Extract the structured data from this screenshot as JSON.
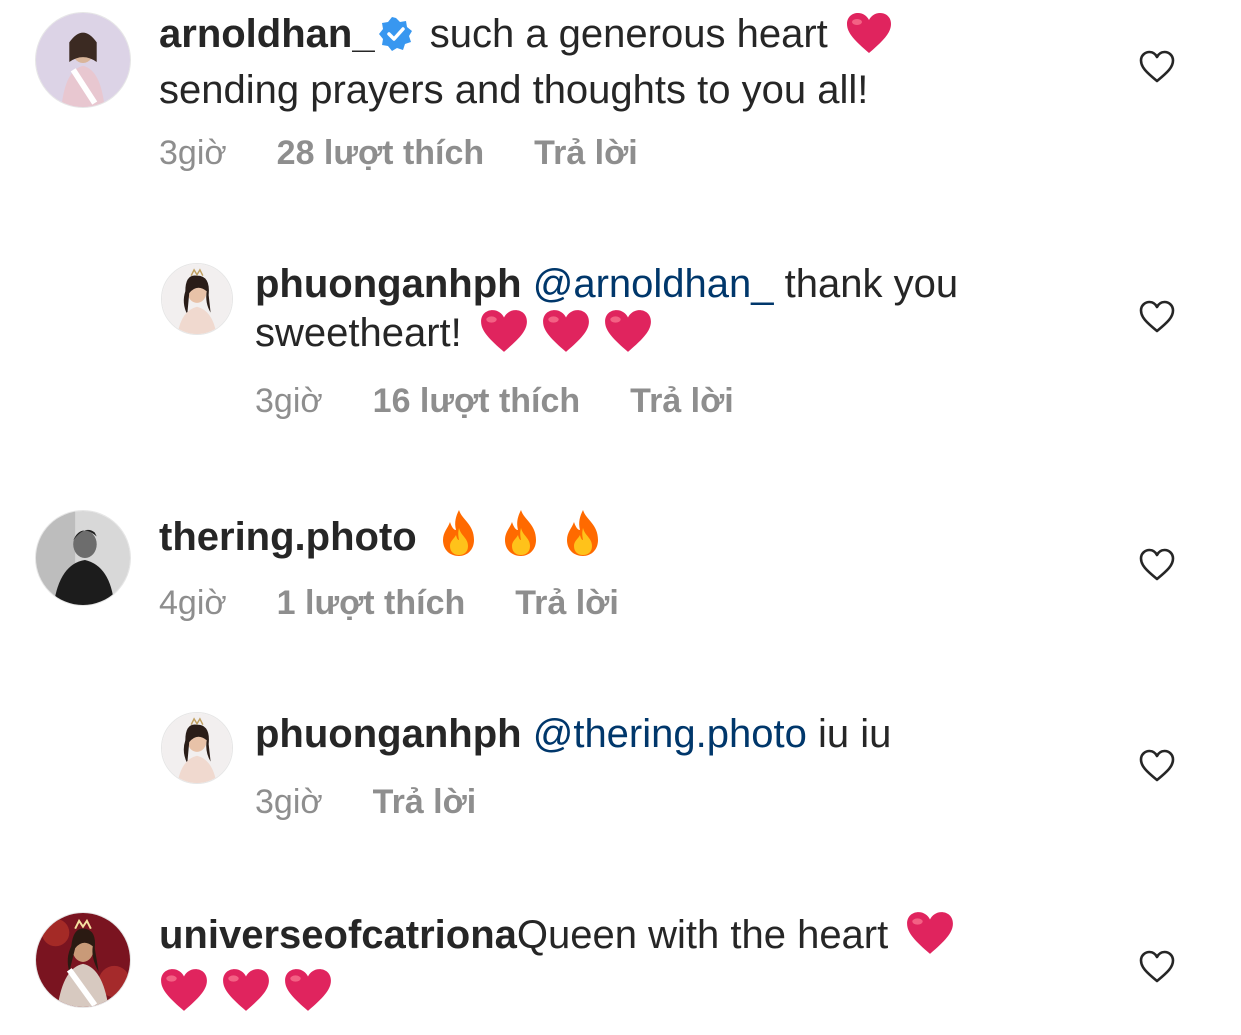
{
  "comments": [
    {
      "username": "arnoldhan_",
      "verified": true,
      "text_line1": "such a generous heart",
      "text_line2": "sending prayers and thoughts to you all!",
      "time": "3giờ",
      "likes": "28 lượt thích",
      "reply": "Trả lời"
    },
    {
      "username": "phuonganhph",
      "mention": "@arnoldhan_",
      "text_line1": "thank you",
      "text_line2": "sweetheart!",
      "time": "3giờ",
      "likes": "16 lượt thích",
      "reply": "Trả lời"
    },
    {
      "username": "thering.photo",
      "time": "4giờ",
      "likes": "1 lượt thích",
      "reply": "Trả lời"
    },
    {
      "username": "phuonganhph",
      "mention": "@thering.photo",
      "text_line1": "iu iu",
      "time": "3giờ",
      "reply": "Trả lời"
    },
    {
      "username": "universeofcatriona",
      "text_line1": "Queen with the heart"
    }
  ],
  "icons": {
    "like": "heart-outline-icon",
    "verified": "verified-badge-icon",
    "heart_emoji": "red-heart-emoji",
    "fire_emoji": "fire-emoji"
  },
  "colors": {
    "text": "#262626",
    "meta": "#8e8e8e",
    "mention": "#00376b",
    "verified": "#3897f0",
    "heart": "#e0245e"
  }
}
